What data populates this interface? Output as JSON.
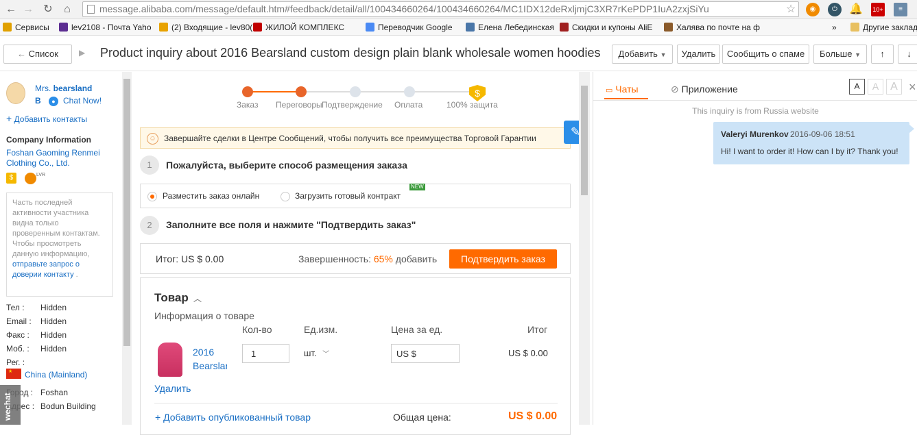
{
  "browser": {
    "url": "message.alibaba.com/message/default.htm#feedback/detail/all/100434660264/100434660264/MC1IDX12deRxljmjC3XR7rKePDP1IuA2zxjSiYu",
    "bookmarks": [
      {
        "label": "Сервисы",
        "color": "#e0a000"
      },
      {
        "label": "lev2108 - Почта Yaho",
        "color": "#5c2d91"
      },
      {
        "label": "(2) Входящие - lev80(",
        "color": "#e8a200"
      },
      {
        "label": "ЖИЛОЙ КОМПЛЕКС",
        "color": "#c00000"
      },
      {
        "label": "Переводчик Google",
        "color": "#4a8af4"
      },
      {
        "label": "Елена Лебединская",
        "color": "#4a76a8"
      },
      {
        "label": "Скидки и купоны AliE",
        "color": "#a02020"
      },
      {
        "label": "Халява по почте на ф",
        "color": "#8a5a2a"
      }
    ],
    "more_bookmarks": "»",
    "other_bookmarks": "Другие заклад"
  },
  "header": {
    "back_label": "Список",
    "subject": "Product inquiry about 2016 Bearsland custom design plain blank wholesale women hoodies",
    "add_label": "Добавить",
    "delete_label": "Удалить",
    "spam_label": "Сообщить о спаме",
    "more_label": "Больше"
  },
  "sidebar": {
    "name_prefix": "Mrs.",
    "name": "bearsland",
    "name_initial": "B",
    "chat_now": "Chat Now!",
    "add_contacts": "Добавить контакты",
    "company_heading": "Company Information",
    "company_name": "Foshan Gaoming Renmei Clothing Co., Ltd.",
    "badge_text": "LVR",
    "notice_text": "Часть последней активности участника видна только проверенным контактам. Чтобы просмотреть данную информацию,",
    "notice_link": "отправьте запрос о доверии контакту",
    "notice_end": ".",
    "fields": [
      {
        "label": "Тел :",
        "value": "Hidden"
      },
      {
        "label": "Email :",
        "value": "Hidden"
      },
      {
        "label": "Факс :",
        "value": "Hidden"
      },
      {
        "label": "Моб. :",
        "value": "Hidden"
      }
    ],
    "region_label": "Рег. :",
    "region_value": "China (Mainland)",
    "city_label": "Город :",
    "city_value": "Foshan",
    "address_label": "Адрес :",
    "address_value": "Bodun Building",
    "wechat_tab": "wechat"
  },
  "progress": {
    "steps": [
      "Заказ",
      "Переговоры",
      "Подтверждение",
      "Оплата",
      "100% защита"
    ],
    "completed_steps": 2
  },
  "order": {
    "banner": "Завершайте сделки в Центре Сообщений, чтобы получить все преимущества Торговой Гарантии",
    "step1_num": "1",
    "step1_title": "Пожалуйста, выберите способ размещения заказа",
    "option_online": "Разместить заказ онлайн",
    "option_upload": "Загрузить готовый контракт",
    "new_badge": "NEW",
    "step2_num": "2",
    "step2_title": "Заполните все поля и нажмите \"Подтвердить заказ\"",
    "total_label": "Итог: US $ 0.00",
    "completeness_label": "Завершенность:",
    "completeness_value": "65%",
    "completeness_action": "добавить",
    "confirm_button": "Подтвердить заказ",
    "goods_title": "Товар",
    "product_info_label": "Информация о товаре",
    "columns": [
      "Кол-во",
      "Ед.изм.",
      "Цена за ед.",
      "Итог"
    ],
    "product_name_line1": "2016",
    "product_name_line2": "Bearslan",
    "quantity": "1",
    "unit": "шт.",
    "unit_price": "US $",
    "line_total": "US $ 0.00",
    "delete_link": "Удалить",
    "add_product": "Добавить опубликованный товар",
    "grand_total_label": "Общая цена:",
    "grand_total_value": "US $ 0.00"
  },
  "chat": {
    "tab_chats": "Чаты",
    "tab_attachment": "Приложение",
    "font_sizes": [
      "A",
      "A",
      "A"
    ],
    "close": "×",
    "notice": "This inquiry is from Russia website",
    "message_author": "Valeryi Murenkov",
    "message_time": "2016-09-06 18:51",
    "message_text": "Hi! I want to order it! How can I by it? Thank you!"
  },
  "colors": {
    "accent": "#ff6a00",
    "link": "#1a6fc4",
    "chat_bubble": "#cce3f7"
  }
}
